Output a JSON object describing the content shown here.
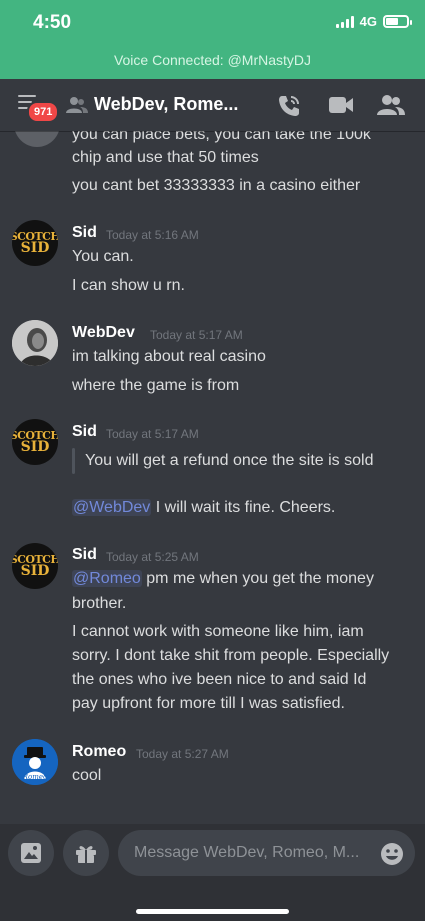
{
  "status": {
    "time": "4:50",
    "network": "4G"
  },
  "voice_banner": "Voice Connected: @MrNastyDJ",
  "header": {
    "unread_badge": "971",
    "title": "WebDev, Rome..."
  },
  "messages": {
    "continued": [
      "you can place bets, you can take the 100k",
      "chip and use that 50 times",
      "you cant bet 33333333 in a casino either"
    ],
    "groups": [
      {
        "author": "Sid",
        "timestamp": "Today at 5:16 AM",
        "lines": [
          "You can.",
          "I can show u rn."
        ]
      },
      {
        "author": "WebDev",
        "timestamp": "Today at 5:17 AM",
        "lines": [
          "im talking about real casino",
          "where the game is from"
        ]
      },
      {
        "author": "Sid",
        "timestamp": "Today at 5:17 AM",
        "quote": "You will get a refund once the site is sold",
        "mention": "@WebDev",
        "reply": " I will wait its fine. Cheers."
      },
      {
        "author": "Sid",
        "timestamp": "Today at 5:25 AM",
        "mention": "@Romeo",
        "line1_rest": " pm me when you get the money",
        "lines": [
          "brother.",
          "I cannot work with someone like him, iam",
          "sorry. I dont take shit from people. Especially",
          "the ones who ive been nice to and said Id",
          "pay upfront for more till I was satisfied."
        ]
      },
      {
        "author": "Romeo",
        "timestamp": "Today at 5:27 AM",
        "lines": [
          "cool"
        ]
      }
    ]
  },
  "avatars": {
    "scotch_top": "SCOTCH",
    "scotch_bottom": "SID",
    "romeo_text": "Romeo"
  },
  "input": {
    "placeholder": "Message WebDev, Romeo, M..."
  },
  "colors": {
    "status_green": "#43b581",
    "background": "#36393f",
    "mention": "#7289da",
    "badge": "#f04747"
  }
}
